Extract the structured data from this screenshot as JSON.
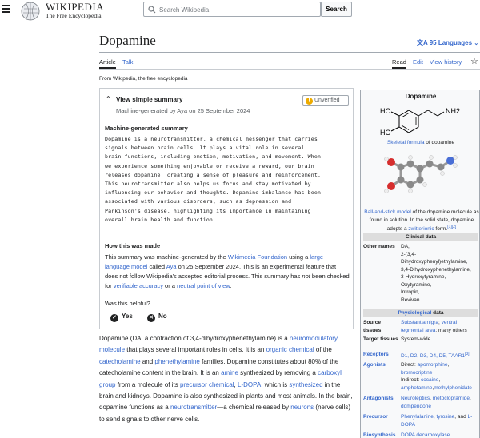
{
  "header": {
    "wordmark": "WIKIPEDIA",
    "tagline": "The Free Encyclopedia",
    "search_placeholder": "Search Wikipedia",
    "search_button": "Search"
  },
  "page": {
    "title": "Dopamine",
    "languages": "95 Languages",
    "tabs": {
      "article": "Article",
      "talk": "Talk",
      "read": "Read",
      "edit": "Edit",
      "history": "View history"
    },
    "from": "From Wikipedia, the free encyclopedia"
  },
  "summary": {
    "heading": "View simple summary",
    "subheading": "Machine-generated by Aya on 25 September 2024",
    "badge": "Unverified",
    "mg_label": "Machine-generated summary",
    "mono_lines": [
      "Dopamine is a neurotransmitter, a chemical messenger that carries",
      "signals between brain cells. It plays a vital role in several",
      "brain functions, including emotion, motivation, and movement. When",
      "we experience something enjoyable or receive a reward, our brain",
      "releases dopamine, creating a sense of pleasure and reinforcement.",
      "This neurotransmitter also helps us focus and stay motivated by",
      "influencing our behavior and thoughts. Dopamine imbalance has been",
      "associated with various disorders, such as depression and",
      "Parkinson's disease, highlighting its importance in maintaining",
      "overall brain health and function."
    ],
    "how_label": "How this was made",
    "how": {
      "t1": "This summary was machine-generated by the ",
      "l1": "Wikimedia Foundation",
      "t2": " using a ",
      "l2": "large language model",
      "t3": " called ",
      "l3": "Aya",
      "t4": " on 25 September 2024. This is an experimental feature that does not follow Wikipedia's accepted editorial process. This summary has ",
      "em": "not",
      "t5": " been checked for ",
      "l4": "verifiable accuracy",
      "t6": " or a ",
      "l5": "neutral point of view",
      "t7": "."
    },
    "helpful": "Was this helpful?",
    "yes": "Yes",
    "no": "No"
  },
  "paragraph": {
    "p1": "Dopamine (DA, a contraction of 3,4-dihydroxyphenethylamine) is",
    "p2": "a ",
    "l_neuromod": "neuromodulatory molecule",
    "p3": " that plays several important roles in cells. It is",
    "p4": "an ",
    "l_organic": "organic chemical",
    "p5": " of the ",
    "l_catechol": "catecholamine",
    "p6": " and ",
    "l_phen": "phenethylamine",
    "p7": " families.",
    "p8": "Dopamine constitutes about 80% of the catecholamine content in the brain.",
    "p9": "It is an ",
    "l_amine": "amine",
    "p10": " synthesized by removing a ",
    "l_carboxyl": "carboxyl group",
    "p11": " from a molecule of",
    "p12": "its ",
    "l_precursor": "precursor chemical",
    "p13": ", ",
    "l_ldopa": "L-DOPA",
    "p14": ", which is ",
    "l_synth": "synthesized",
    "p15": " in the brain and",
    "p16": "kidneys. Dopamine is also synthesized in plants and most animals. In the",
    "p17": "brain, dopamine functions as a ",
    "l_nt": "neurotransmitter",
    "p18": "—a chemical released",
    "p19": "by ",
    "l_neurons": "neurons",
    "p20": " (nerve cells) to send signals to other nerve cells."
  },
  "infobox": {
    "title": "Dopamine",
    "cap1_link": "Skeletal formula",
    "cap1_text": " of dopamine",
    "cap2_link1": "Ball-and-stick model",
    "cap2_t1": " of the dopamine molecule as found in solution. In the solid state, dopamine adopts a ",
    "cap2_link2": "zwitterionic",
    "cap2_t2": " form.",
    "cap2_ref": "[1][2]",
    "clinical": "Clinical data",
    "other_names_k": "Other names",
    "other_names": [
      "DA,",
      "2-(3,4-",
      "Dihydroxyphenyl)ethylamine,",
      "3,4-Dihydroxyphenethylamine,",
      "3-Hydroxytyramine,",
      "Oxytyramine,",
      "Intropin,",
      "Revivan"
    ],
    "phys_link": "Physiological",
    "phys_text": " data",
    "source_k": "Source tissues",
    "source_l1": "Substantia nigra",
    "source_t1": "; ",
    "source_l2": "ventral tegmental area",
    "source_t2": "; many others",
    "target_k": "Target tissues",
    "target_v": "System-wide",
    "receptors_k": "Receptors",
    "receptors_v": "D1, D2, D3, D4, D5, TAAR1",
    "receptors_ref": "[3]",
    "agonists_k": "Agonists",
    "ag_t1": "Direct: ",
    "ag_l1": "apomorphine",
    "ag_l2": "bromocriptine",
    "ag_t2": "Indirect: ",
    "ag_l3": "cocaine",
    "ag_l4": "amphetamine",
    "ag_l5": "methylphenidate",
    "antag_k": "Antagonists",
    "antag_l1": "Neuroleptics",
    "antag_l2": "metoclopramide",
    "antag_l3": "domperidone",
    "prec_k": "Precursor",
    "prec_l1": "Phenylalanine",
    "prec_l2": "tyrosine",
    "prec_l3": "L-DOPA",
    "bio_k": "Biosynthesis",
    "bio_v": "DOPA decarboxylase",
    "struct_labels": {
      "ho1": "HO",
      "ho2": "HO",
      "nh2": "NH2"
    }
  },
  "colors": {
    "link": "#3366cc",
    "text": "#202122",
    "badge_warn": "#edab00",
    "infobox_bg": "#f8f9fa",
    "band": "#dddddd"
  }
}
